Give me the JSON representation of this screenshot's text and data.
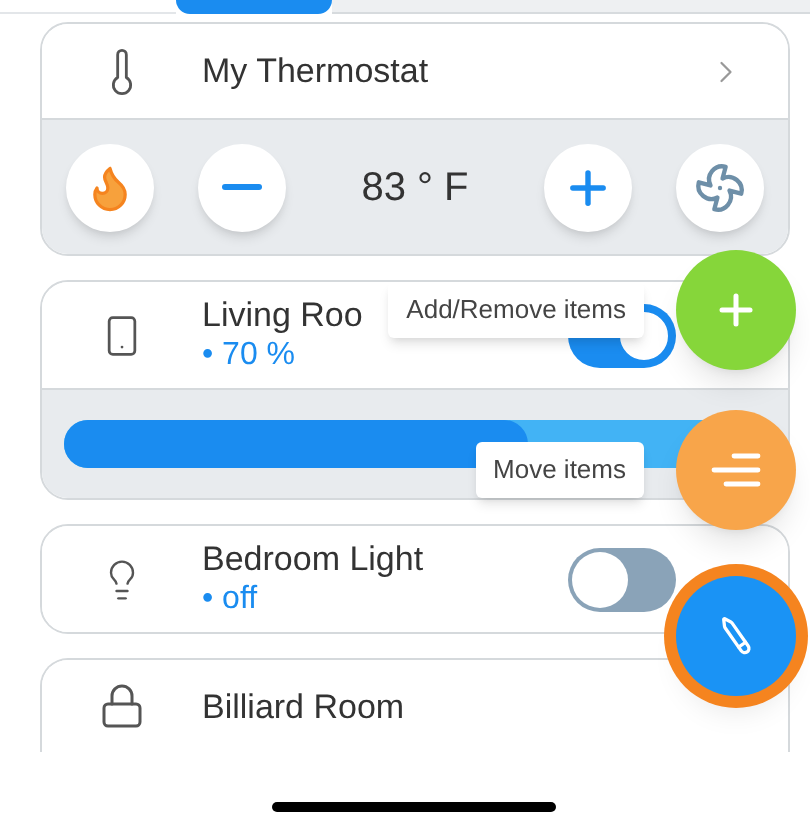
{
  "thermostat": {
    "name": "My Thermostat",
    "temperature": "83 ° F"
  },
  "devices": [
    {
      "kind": "dimmer",
      "name": "Living Roo",
      "status": "• 70 %",
      "on": true,
      "level": 0.66
    },
    {
      "kind": "switch",
      "name": "Bedroom Light",
      "status": "• off",
      "on": false
    },
    {
      "kind": "lock",
      "name": "Billiard Room"
    }
  ],
  "fab_menu": [
    {
      "kind": "add",
      "tooltip": "Add/Remove items",
      "selected": false
    },
    {
      "kind": "move",
      "tooltip": "Move items",
      "selected": false
    },
    {
      "kind": "edit",
      "selected": true
    }
  ]
}
